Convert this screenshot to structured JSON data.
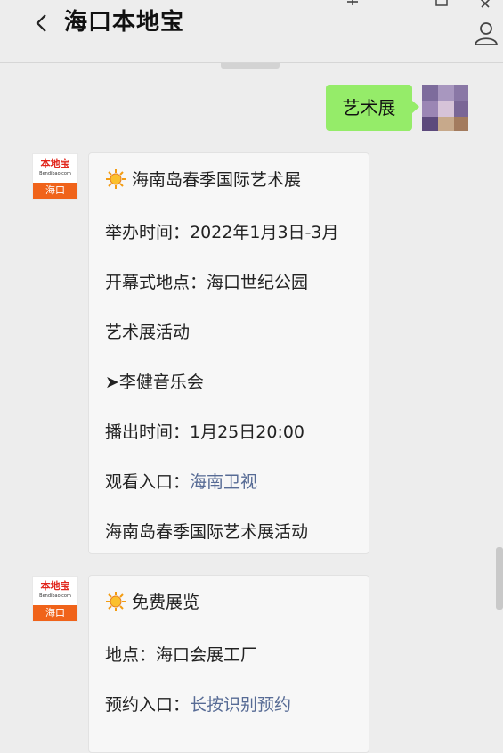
{
  "header": {
    "title": "海口本地宝",
    "back_icon": "chevron-left-icon",
    "profile_icon": "person-icon"
  },
  "user_message": {
    "text": "艺术展"
  },
  "bot_avatar": {
    "brand": "本地宝",
    "url": "Bendibao.com",
    "city": "海口"
  },
  "card1": {
    "title": "海南岛春季国际艺术展",
    "lines": [
      "举办时间：2022年1月3日-3月",
      "开幕式地点：海口世纪公园",
      "艺术展活动",
      "➤李健音乐会",
      "播出时间：1月25日20:00"
    ],
    "watch_label": "观看入口：",
    "watch_link": "海南卫视",
    "footer": "海南岛春季国际艺术展活动"
  },
  "card2": {
    "title": "免费展览",
    "location": "地点：海口会展工厂",
    "reserve_label": "预约入口：",
    "reserve_link": "长按识别预约"
  },
  "colors": {
    "background": "#ededed",
    "user_bubble": "#95ec69",
    "link": "#576b95",
    "brand_orange": "#f0631a",
    "brand_red": "#e1251b"
  }
}
